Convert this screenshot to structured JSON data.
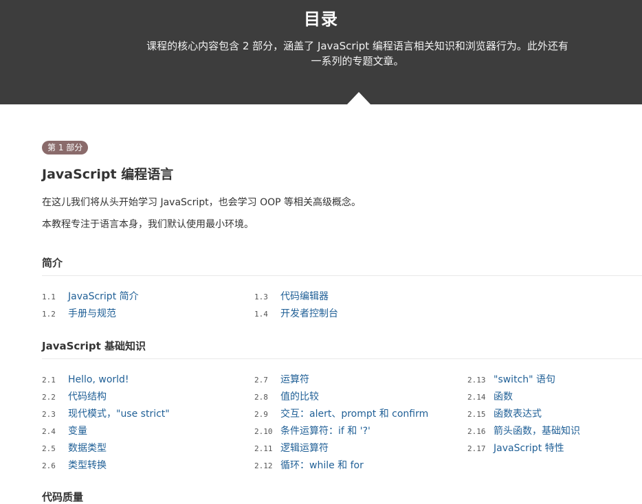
{
  "header": {
    "title": "目录",
    "subtitle_line1": "课程的核心内容包含 2 部分，涵盖了 JavaScript 编程语言相关知识和浏览器行为。此外还有",
    "subtitle_line2": "一系列的专题文章。"
  },
  "part": {
    "badge": "第 1 部分",
    "title": "JavaScript 编程语言",
    "desc1": "在这儿我们将从头开始学习 JavaScript，也会学习 OOP 等相关高级概念。",
    "desc2": "本教程专注于语言本身，我们默认使用最小环境。"
  },
  "sections": [
    {
      "title": "简介",
      "items": [
        {
          "num": "1.1",
          "label": "JavaScript 简介"
        },
        {
          "num": "1.2",
          "label": "手册与规范"
        },
        {
          "num": "1.3",
          "label": "代码编辑器"
        },
        {
          "num": "1.4",
          "label": "开发者控制台"
        }
      ]
    },
    {
      "title": "JavaScript 基础知识",
      "items": [
        {
          "num": "2.1",
          "label": "Hello, world!"
        },
        {
          "num": "2.2",
          "label": "代码结构"
        },
        {
          "num": "2.3",
          "label": "现代模式，\"use strict\""
        },
        {
          "num": "2.4",
          "label": "变量"
        },
        {
          "num": "2.5",
          "label": "数据类型"
        },
        {
          "num": "2.6",
          "label": "类型转换"
        },
        {
          "num": "2.7",
          "label": "运算符"
        },
        {
          "num": "2.8",
          "label": "值的比较"
        },
        {
          "num": "2.9",
          "label": "交互：alert、prompt 和 confirm"
        },
        {
          "num": "2.10",
          "label": "条件运算符：if 和 '?'"
        },
        {
          "num": "2.11",
          "label": "逻辑运算符"
        },
        {
          "num": "2.12",
          "label": "循环：while 和 for"
        },
        {
          "num": "2.13",
          "label": "\"switch\" 语句"
        },
        {
          "num": "2.14",
          "label": "函数"
        },
        {
          "num": "2.15",
          "label": "函数表达式"
        },
        {
          "num": "2.16",
          "label": "箭头函数，基础知识"
        },
        {
          "num": "2.17",
          "label": "JavaScript 特性"
        }
      ]
    },
    {
      "title": "代码质量",
      "items": []
    }
  ],
  "colors": {
    "header_bg": "#3d3d3d",
    "badge_bg": "#8a6b6b",
    "link": "#1f5f96"
  }
}
